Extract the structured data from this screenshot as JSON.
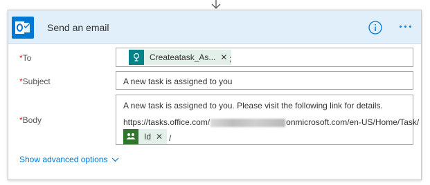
{
  "header": {
    "title": "Send an email",
    "icon": "outlook-icon",
    "accent_color": "#0078d4"
  },
  "fields": {
    "to": {
      "required_mark": "*",
      "label": "To",
      "token_label": "Createatask_As...",
      "token_icon": "sharepoint-list-icon",
      "token_color": "#038387",
      "separator": ";"
    },
    "subject": {
      "required_mark": "*",
      "label": "Subject",
      "value": "A new task is assigned to you"
    },
    "body": {
      "required_mark": "*",
      "label": "Body",
      "line1": "A new task is assigned to you. Please visit the following link for details.",
      "line2_prefix": "https://tasks.office.com/",
      "line2_suffix": "onmicrosoft.com/en-US/Home/Task/",
      "token_label": "Id",
      "token_icon": "planner-icon",
      "token_color": "#31752f",
      "trailing": "/"
    }
  },
  "advanced": {
    "label": "Show advanced options"
  }
}
